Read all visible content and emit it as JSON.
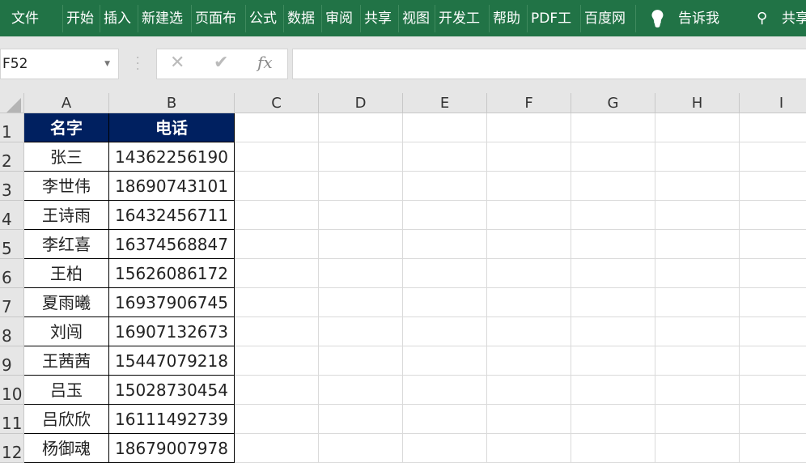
{
  "ribbon": {
    "tabs": [
      "文件",
      "开始",
      "插入",
      "新建选",
      "页面布",
      "公式",
      "数据",
      "审阅",
      "共享",
      "视图",
      "开发工",
      "帮助",
      "PDF工",
      "百度网"
    ],
    "tell_me": "告诉我",
    "share": "共享"
  },
  "formula_bar": {
    "name_box": "F52",
    "cancel": "✕",
    "enter": "✔",
    "fx": "fx",
    "value": ""
  },
  "columns": [
    "A",
    "B",
    "C",
    "D",
    "E",
    "F",
    "G",
    "H",
    "I"
  ],
  "rows": [
    "1",
    "2",
    "3",
    "4",
    "5",
    "6",
    "7",
    "8",
    "9",
    "10",
    "11",
    "12"
  ],
  "table": {
    "headers": [
      "名字",
      "电话"
    ],
    "data": [
      [
        "张三",
        "14362256190"
      ],
      [
        "李世伟",
        "18690743101"
      ],
      [
        "王诗雨",
        "16432456711"
      ],
      [
        "李红喜",
        "16374568847"
      ],
      [
        "王柏",
        "15626086172"
      ],
      [
        "夏雨曦",
        "16937906745"
      ],
      [
        "刘闯",
        "16907132673"
      ],
      [
        "王茜茜",
        "15447079218"
      ],
      [
        "吕玉",
        "15028730454"
      ],
      [
        "吕欣欣",
        "16111492739"
      ],
      [
        "杨御魂",
        "18679007978"
      ]
    ]
  },
  "colors": {
    "ribbon": "#217346",
    "header_fill": "#002060"
  }
}
